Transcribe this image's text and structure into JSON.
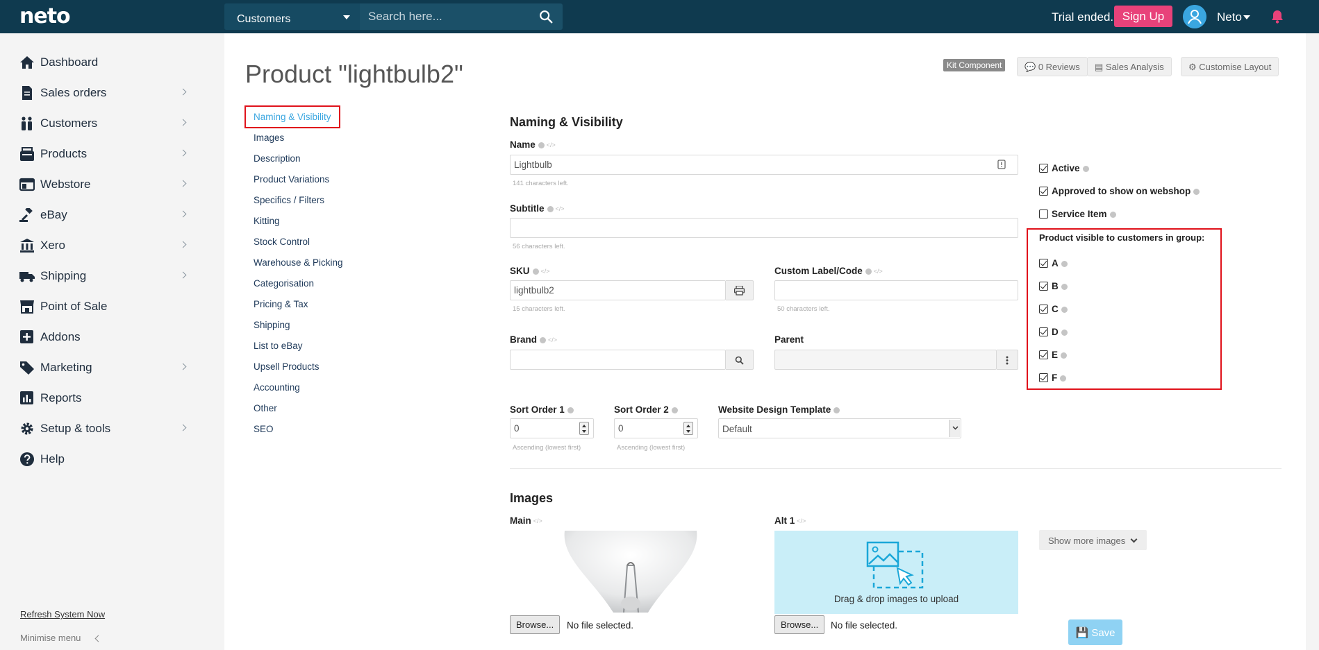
{
  "header": {
    "logo": "neto",
    "search_category": "Customers",
    "search_placeholder": "Search here...",
    "trial_text": "Trial ended.",
    "signup_label": "Sign Up",
    "user_name": "Neto"
  },
  "sidebar": {
    "items": [
      {
        "label": "Dashboard",
        "icon": "home-icon",
        "has_children": false
      },
      {
        "label": "Sales orders",
        "icon": "document-icon",
        "has_children": true
      },
      {
        "label": "Customers",
        "icon": "users-icon",
        "has_children": true
      },
      {
        "label": "Products",
        "icon": "box-icon",
        "has_children": true
      },
      {
        "label": "Webstore",
        "icon": "browser-icon",
        "has_children": true
      },
      {
        "label": "eBay",
        "icon": "gavel-icon",
        "has_children": true
      },
      {
        "label": "Xero",
        "icon": "bank-icon",
        "has_children": true
      },
      {
        "label": "Shipping",
        "icon": "truck-icon",
        "has_children": true
      },
      {
        "label": "Point of Sale",
        "icon": "storefront-icon",
        "has_children": false
      },
      {
        "label": "Addons",
        "icon": "plus-square-icon",
        "has_children": false
      },
      {
        "label": "Marketing",
        "icon": "tag-icon",
        "has_children": true
      },
      {
        "label": "Reports",
        "icon": "bar-chart-icon",
        "has_children": false
      },
      {
        "label": "Setup & tools",
        "icon": "gear-icon",
        "has_children": true
      },
      {
        "label": "Help",
        "icon": "question-icon",
        "has_children": false
      }
    ],
    "refresh_label": "Refresh System Now",
    "minimise_label": "Minimise menu"
  },
  "page": {
    "title": "Product \"lightbulb2\"",
    "kit_badge": "Kit Component",
    "reviews_label": "0 Reviews",
    "sales_analysis_label": "Sales Analysis",
    "customise_label": "Customise Layout"
  },
  "subnav": [
    "Naming & Visibility",
    "Images",
    "Description",
    "Product Variations",
    "Specifics / Filters",
    "Kitting",
    "Stock Control",
    "Warehouse & Picking",
    "Categorisation",
    "Pricing & Tax",
    "Shipping",
    "List to eBay",
    "Upsell Products",
    "Accounting",
    "Other",
    "SEO"
  ],
  "naming": {
    "section_title": "Naming & Visibility",
    "name_label": "Name",
    "name_value": "Lightbulb",
    "name_hint": "141 characters left.",
    "subtitle_label": "Subtitle",
    "subtitle_value": "",
    "subtitle_hint": "56 characters left.",
    "sku_label": "SKU",
    "sku_value": "lightbulb2",
    "sku_hint": "15 characters left.",
    "custom_label": "Custom Label/Code",
    "custom_value": "",
    "custom_hint": "50 characters left.",
    "brand_label": "Brand",
    "brand_value": "",
    "parent_label": "Parent",
    "parent_value": "",
    "sort1_label": "Sort Order 1",
    "sort1_value": "0",
    "sort1_hint": "Ascending (lowest first)",
    "sort2_label": "Sort Order 2",
    "sort2_value": "0",
    "sort2_hint": "Ascending (lowest first)",
    "template_label": "Website Design Template",
    "template_value": "Default",
    "checks": [
      {
        "label": "Active",
        "checked": true
      },
      {
        "label": "Approved to show on webshop",
        "checked": true
      },
      {
        "label": "Service Item",
        "checked": false
      }
    ],
    "groups_title": "Product visible to customers in group:",
    "groups": [
      {
        "label": "A",
        "checked": true
      },
      {
        "label": "B",
        "checked": true
      },
      {
        "label": "C",
        "checked": true
      },
      {
        "label": "D",
        "checked": true
      },
      {
        "label": "E",
        "checked": true
      },
      {
        "label": "F",
        "checked": true
      }
    ]
  },
  "images": {
    "section_title": "Images",
    "main_label": "Main",
    "alt_label": "Alt 1",
    "drop_text": "Drag & drop images to upload",
    "browse_label": "Browse...",
    "no_file_text": "No file selected.",
    "show_more_label": "Show more images",
    "save_label": "Save"
  },
  "colors": {
    "topbar": "#0f3a4f",
    "accent": "#3aa6e0",
    "signup": "#e8427a",
    "highlight": "#e0121b"
  }
}
